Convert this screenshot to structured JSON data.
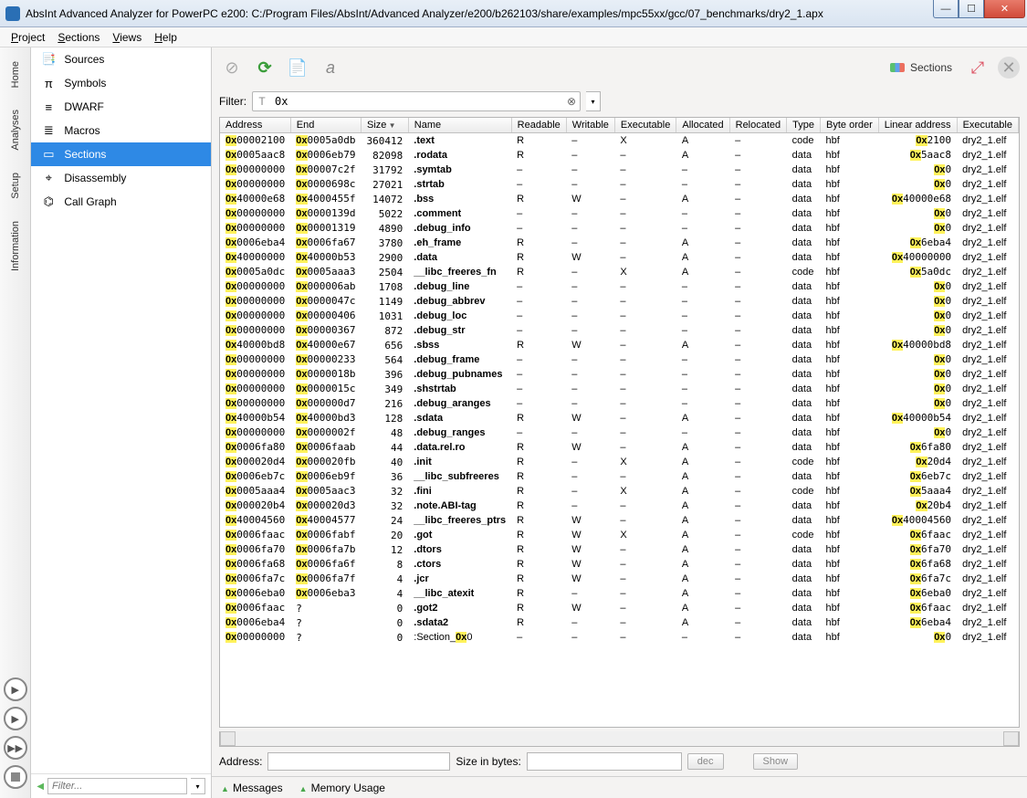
{
  "window": {
    "title": "AbsInt Advanced Analyzer for PowerPC e200: C:/Program Files/AbsInt/Advanced Analyzer/e200/b262103/share/examples/mpc55xx/gcc/07_benchmarks/dry2_1.apx"
  },
  "menubar": {
    "items": [
      "Project",
      "Sections",
      "Views",
      "Help"
    ]
  },
  "vtabs": [
    "Home",
    "Analyses",
    "Setup",
    "Information"
  ],
  "sidebar": {
    "items": [
      {
        "label": "Sources",
        "icon": "sources"
      },
      {
        "label": "Symbols",
        "icon": "pi"
      },
      {
        "label": "DWARF",
        "icon": "dwarf"
      },
      {
        "label": "Macros",
        "icon": "macros"
      },
      {
        "label": "Sections",
        "icon": "sections"
      },
      {
        "label": "Disassembly",
        "icon": "disasm"
      },
      {
        "label": "Call Graph",
        "icon": "callgraph"
      }
    ],
    "selected": 4,
    "filter_placeholder": "Filter..."
  },
  "toolbar": {
    "sections_label": "Sections"
  },
  "filter": {
    "label": "Filter:",
    "value": "0x"
  },
  "table": {
    "columns": [
      "Address",
      "End",
      "Size",
      "Name",
      "Readable",
      "Writable",
      "Executable",
      "Allocated",
      "Relocated",
      "Type",
      "Byte order",
      "Linear address",
      "Executable"
    ],
    "sort_col": 2,
    "rows": [
      {
        "addr": "00002100",
        "end": "0005a0db",
        "size": 360412,
        "name": ".text",
        "r": "R",
        "w": "–",
        "x": "X",
        "a": "A",
        "rel": "–",
        "type": "code",
        "bo": "hbf",
        "lin": "2100",
        "exe": "dry2_1.elf"
      },
      {
        "addr": "0005aac8",
        "end": "0006eb79",
        "size": 82098,
        "name": ".rodata",
        "r": "R",
        "w": "–",
        "x": "–",
        "a": "A",
        "rel": "–",
        "type": "data",
        "bo": "hbf",
        "lin": "5aac8",
        "exe": "dry2_1.elf"
      },
      {
        "addr": "00000000",
        "end": "00007c2f",
        "size": 31792,
        "name": ".symtab",
        "r": "–",
        "w": "–",
        "x": "–",
        "a": "–",
        "rel": "–",
        "type": "data",
        "bo": "hbf",
        "lin": "0",
        "exe": "dry2_1.elf"
      },
      {
        "addr": "00000000",
        "end": "0000698c",
        "size": 27021,
        "name": ".strtab",
        "r": "–",
        "w": "–",
        "x": "–",
        "a": "–",
        "rel": "–",
        "type": "data",
        "bo": "hbf",
        "lin": "0",
        "exe": "dry2_1.elf"
      },
      {
        "addr": "40000e68",
        "end": "4000455f",
        "size": 14072,
        "name": ".bss",
        "r": "R",
        "w": "W",
        "x": "–",
        "a": "A",
        "rel": "–",
        "type": "data",
        "bo": "hbf",
        "lin": "40000e68",
        "exe": "dry2_1.elf"
      },
      {
        "addr": "00000000",
        "end": "0000139d",
        "size": 5022,
        "name": ".comment",
        "r": "–",
        "w": "–",
        "x": "–",
        "a": "–",
        "rel": "–",
        "type": "data",
        "bo": "hbf",
        "lin": "0",
        "exe": "dry2_1.elf"
      },
      {
        "addr": "00000000",
        "end": "00001319",
        "size": 4890,
        "name": ".debug_info",
        "r": "–",
        "w": "–",
        "x": "–",
        "a": "–",
        "rel": "–",
        "type": "data",
        "bo": "hbf",
        "lin": "0",
        "exe": "dry2_1.elf"
      },
      {
        "addr": "0006eba4",
        "end": "0006fa67",
        "size": 3780,
        "name": ".eh_frame",
        "r": "R",
        "w": "–",
        "x": "–",
        "a": "A",
        "rel": "–",
        "type": "data",
        "bo": "hbf",
        "lin": "6eba4",
        "exe": "dry2_1.elf"
      },
      {
        "addr": "40000000",
        "end": "40000b53",
        "size": 2900,
        "name": ".data",
        "r": "R",
        "w": "W",
        "x": "–",
        "a": "A",
        "rel": "–",
        "type": "data",
        "bo": "hbf",
        "lin": "40000000",
        "exe": "dry2_1.elf"
      },
      {
        "addr": "0005a0dc",
        "end": "0005aaa3",
        "size": 2504,
        "name": "__libc_freeres_fn",
        "r": "R",
        "w": "–",
        "x": "X",
        "a": "A",
        "rel": "–",
        "type": "code",
        "bo": "hbf",
        "lin": "5a0dc",
        "exe": "dry2_1.elf"
      },
      {
        "addr": "00000000",
        "end": "000006ab",
        "size": 1708,
        "name": ".debug_line",
        "r": "–",
        "w": "–",
        "x": "–",
        "a": "–",
        "rel": "–",
        "type": "data",
        "bo": "hbf",
        "lin": "0",
        "exe": "dry2_1.elf"
      },
      {
        "addr": "00000000",
        "end": "0000047c",
        "size": 1149,
        "name": ".debug_abbrev",
        "r": "–",
        "w": "–",
        "x": "–",
        "a": "–",
        "rel": "–",
        "type": "data",
        "bo": "hbf",
        "lin": "0",
        "exe": "dry2_1.elf"
      },
      {
        "addr": "00000000",
        "end": "00000406",
        "size": 1031,
        "name": ".debug_loc",
        "r": "–",
        "w": "–",
        "x": "–",
        "a": "–",
        "rel": "–",
        "type": "data",
        "bo": "hbf",
        "lin": "0",
        "exe": "dry2_1.elf"
      },
      {
        "addr": "00000000",
        "end": "00000367",
        "size": 872,
        "name": ".debug_str",
        "r": "–",
        "w": "–",
        "x": "–",
        "a": "–",
        "rel": "–",
        "type": "data",
        "bo": "hbf",
        "lin": "0",
        "exe": "dry2_1.elf"
      },
      {
        "addr": "40000bd8",
        "end": "40000e67",
        "size": 656,
        "name": ".sbss",
        "r": "R",
        "w": "W",
        "x": "–",
        "a": "A",
        "rel": "–",
        "type": "data",
        "bo": "hbf",
        "lin": "40000bd8",
        "exe": "dry2_1.elf"
      },
      {
        "addr": "00000000",
        "end": "00000233",
        "size": 564,
        "name": ".debug_frame",
        "r": "–",
        "w": "–",
        "x": "–",
        "a": "–",
        "rel": "–",
        "type": "data",
        "bo": "hbf",
        "lin": "0",
        "exe": "dry2_1.elf"
      },
      {
        "addr": "00000000",
        "end": "0000018b",
        "size": 396,
        "name": ".debug_pubnames",
        "r": "–",
        "w": "–",
        "x": "–",
        "a": "–",
        "rel": "–",
        "type": "data",
        "bo": "hbf",
        "lin": "0",
        "exe": "dry2_1.elf"
      },
      {
        "addr": "00000000",
        "end": "0000015c",
        "size": 349,
        "name": ".shstrtab",
        "r": "–",
        "w": "–",
        "x": "–",
        "a": "–",
        "rel": "–",
        "type": "data",
        "bo": "hbf",
        "lin": "0",
        "exe": "dry2_1.elf"
      },
      {
        "addr": "00000000",
        "end": "000000d7",
        "size": 216,
        "name": ".debug_aranges",
        "r": "–",
        "w": "–",
        "x": "–",
        "a": "–",
        "rel": "–",
        "type": "data",
        "bo": "hbf",
        "lin": "0",
        "exe": "dry2_1.elf"
      },
      {
        "addr": "40000b54",
        "end": "40000bd3",
        "size": 128,
        "name": ".sdata",
        "r": "R",
        "w": "W",
        "x": "–",
        "a": "A",
        "rel": "–",
        "type": "data",
        "bo": "hbf",
        "lin": "40000b54",
        "exe": "dry2_1.elf"
      },
      {
        "addr": "00000000",
        "end": "0000002f",
        "size": 48,
        "name": ".debug_ranges",
        "r": "–",
        "w": "–",
        "x": "–",
        "a": "–",
        "rel": "–",
        "type": "data",
        "bo": "hbf",
        "lin": "0",
        "exe": "dry2_1.elf"
      },
      {
        "addr": "0006fa80",
        "end": "0006faab",
        "size": 44,
        "name": ".data.rel.ro",
        "r": "R",
        "w": "W",
        "x": "–",
        "a": "A",
        "rel": "–",
        "type": "data",
        "bo": "hbf",
        "lin": "6fa80",
        "exe": "dry2_1.elf"
      },
      {
        "addr": "000020d4",
        "end": "000020fb",
        "size": 40,
        "name": ".init",
        "r": "R",
        "w": "–",
        "x": "X",
        "a": "A",
        "rel": "–",
        "type": "code",
        "bo": "hbf",
        "lin": "20d4",
        "exe": "dry2_1.elf"
      },
      {
        "addr": "0006eb7c",
        "end": "0006eb9f",
        "size": 36,
        "name": "__libc_subfreeres",
        "r": "R",
        "w": "–",
        "x": "–",
        "a": "A",
        "rel": "–",
        "type": "data",
        "bo": "hbf",
        "lin": "6eb7c",
        "exe": "dry2_1.elf"
      },
      {
        "addr": "0005aaa4",
        "end": "0005aac3",
        "size": 32,
        "name": ".fini",
        "r": "R",
        "w": "–",
        "x": "X",
        "a": "A",
        "rel": "–",
        "type": "code",
        "bo": "hbf",
        "lin": "5aaa4",
        "exe": "dry2_1.elf"
      },
      {
        "addr": "000020b4",
        "end": "000020d3",
        "size": 32,
        "name": ".note.ABI-tag",
        "r": "R",
        "w": "–",
        "x": "–",
        "a": "A",
        "rel": "–",
        "type": "data",
        "bo": "hbf",
        "lin": "20b4",
        "exe": "dry2_1.elf"
      },
      {
        "addr": "40004560",
        "end": "40004577",
        "size": 24,
        "name": "__libc_freeres_ptrs",
        "r": "R",
        "w": "W",
        "x": "–",
        "a": "A",
        "rel": "–",
        "type": "data",
        "bo": "hbf",
        "lin": "40004560",
        "exe": "dry2_1.elf"
      },
      {
        "addr": "0006faac",
        "end": "0006fabf",
        "size": 20,
        "name": ".got",
        "r": "R",
        "w": "W",
        "x": "X",
        "a": "A",
        "rel": "–",
        "type": "code",
        "bo": "hbf",
        "lin": "6faac",
        "exe": "dry2_1.elf"
      },
      {
        "addr": "0006fa70",
        "end": "0006fa7b",
        "size": 12,
        "name": ".dtors",
        "r": "R",
        "w": "W",
        "x": "–",
        "a": "A",
        "rel": "–",
        "type": "data",
        "bo": "hbf",
        "lin": "6fa70",
        "exe": "dry2_1.elf"
      },
      {
        "addr": "0006fa68",
        "end": "0006fa6f",
        "size": 8,
        "name": ".ctors",
        "r": "R",
        "w": "W",
        "x": "–",
        "a": "A",
        "rel": "–",
        "type": "data",
        "bo": "hbf",
        "lin": "6fa68",
        "exe": "dry2_1.elf"
      },
      {
        "addr": "0006fa7c",
        "end": "0006fa7f",
        "size": 4,
        "name": ".jcr",
        "r": "R",
        "w": "W",
        "x": "–",
        "a": "A",
        "rel": "–",
        "type": "data",
        "bo": "hbf",
        "lin": "6fa7c",
        "exe": "dry2_1.elf"
      },
      {
        "addr": "0006eba0",
        "end": "0006eba3",
        "size": 4,
        "name": "__libc_atexit",
        "r": "R",
        "w": "–",
        "x": "–",
        "a": "A",
        "rel": "–",
        "type": "data",
        "bo": "hbf",
        "lin": "6eba0",
        "exe": "dry2_1.elf"
      },
      {
        "addr": "0006faac",
        "end": "?",
        "size": 0,
        "name": ".got2",
        "r": "R",
        "w": "W",
        "x": "–",
        "a": "A",
        "rel": "–",
        "type": "data",
        "bo": "hbf",
        "lin": "6faac",
        "exe": "dry2_1.elf"
      },
      {
        "addr": "0006eba4",
        "end": "?",
        "size": 0,
        "name": ".sdata2",
        "r": "R",
        "w": "–",
        "x": "–",
        "a": "A",
        "rel": "–",
        "type": "data",
        "bo": "hbf",
        "lin": "6eba4",
        "exe": "dry2_1.elf"
      },
      {
        "addr": "00000000",
        "end": "?",
        "size": 0,
        "name": ":Section_0x0",
        "r": "–",
        "w": "–",
        "x": "–",
        "a": "–",
        "rel": "–",
        "type": "data",
        "bo": "hbf",
        "lin": "0",
        "exe": "dry2_1.elf",
        "name_hl": true
      }
    ]
  },
  "addr_bar": {
    "address_label": "Address:",
    "size_label": "Size in bytes:",
    "dec_label": "dec",
    "show_label": "Show"
  },
  "status": {
    "messages": "Messages",
    "memory": "Memory Usage"
  }
}
